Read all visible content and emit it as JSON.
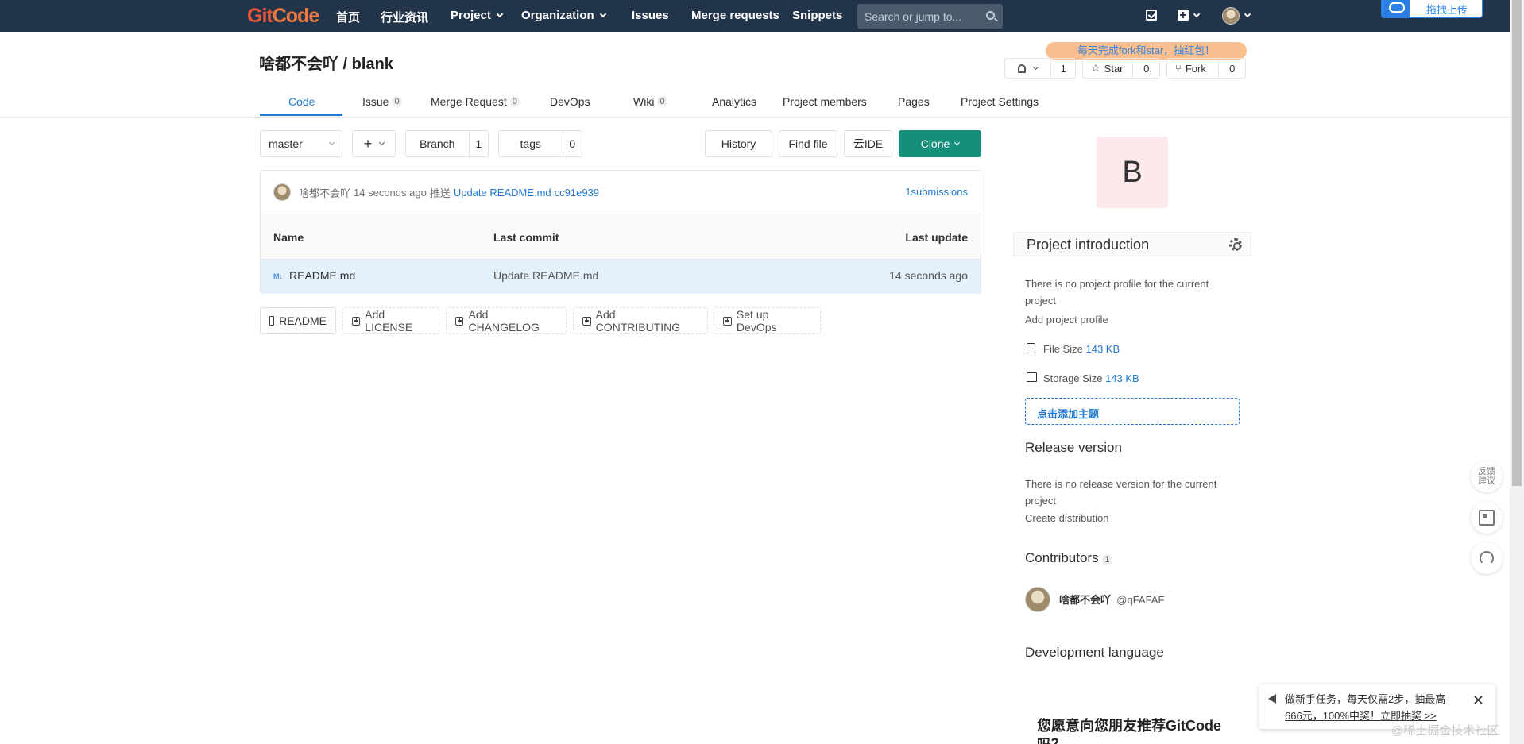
{
  "nav": {
    "logo_a": "Git",
    "logo_b": "Code",
    "home": "首页",
    "news": "行业资讯",
    "project": "Project",
    "organization": "Organization",
    "issues": "Issues",
    "merge_requests": "Merge requests",
    "snippets": "Snippets",
    "search_placeholder": "Search or jump to...",
    "upload": "拖拽上传"
  },
  "project": {
    "title": "啥都不会吖 / blank",
    "promo": "每天完成fork和star，抽红包！",
    "notify_count": "1",
    "star_label": "Star",
    "star_count": "0",
    "fork_label": "Fork",
    "fork_count": "0"
  },
  "tabs": [
    {
      "label": "Code",
      "count": ""
    },
    {
      "label": "Issue",
      "count": "0"
    },
    {
      "label": "Merge Request",
      "count": "0"
    },
    {
      "label": "DevOps",
      "count": ""
    },
    {
      "label": "Wiki",
      "count": "0"
    },
    {
      "label": "Analytics",
      "count": ""
    },
    {
      "label": "Project members",
      "count": ""
    },
    {
      "label": "Pages",
      "count": ""
    },
    {
      "label": "Project Settings",
      "count": ""
    }
  ],
  "repo": {
    "branch_select": "master",
    "branch_label": "Branch",
    "branch_count": "1",
    "tags_label": "tags",
    "tags_count": "0",
    "history": "History",
    "find_file": "Find file",
    "ide": "云IDE",
    "clone": "Clone"
  },
  "commit": {
    "author": "啥都不会吖",
    "time": "14 seconds ago",
    "action": "推送",
    "message": "Update README.md",
    "sha": "cc91e939",
    "submissions": "1submissions"
  },
  "table": {
    "headers": [
      "Name",
      "Last commit",
      "Last update"
    ],
    "rows": [
      {
        "icon": "M↓",
        "name": "README.md",
        "commit": "Update README.md",
        "updated": "14 seconds ago"
      }
    ]
  },
  "doc_buttons": [
    "README",
    "Add LICENSE",
    "Add CHANGELOG",
    "Add CONTRIBUTING",
    "Set up DevOps"
  ],
  "sidebar": {
    "avatar_letter": "B",
    "intro_title": "Project introduction",
    "no_profile": "There is no project profile for the current project",
    "add_profile": "Add project profile",
    "file_size_label": "File Size",
    "file_size": "143 KB",
    "storage_label": "Storage Size",
    "storage_size": "143 KB",
    "add_topic": "点击添加主题",
    "release_title": "Release version",
    "no_release": "There is no release version for the current project",
    "create_dist": "Create distribution",
    "contributors_title": "Contributors",
    "contributors_count": "1",
    "contributor_name": "啥都不会吖",
    "contributor_handle": "@qFAFAF",
    "dev_lang_title": "Development language",
    "recommend": "您愿意向您朋友推荐GitCode吗？"
  },
  "sidetools": {
    "feedback": "反馈建议"
  },
  "notice": {
    "text": "做新手任务，每天仅需2步，抽最高666元，100%中奖！立即抽奖 >>",
    "close": "✕"
  },
  "watermark": "@稀土掘金技术社区",
  "colors": {
    "nav_bg": "#22344a",
    "accent": "#1f78d1",
    "clone": "#168f7a",
    "promo": "#fbbf8f"
  }
}
